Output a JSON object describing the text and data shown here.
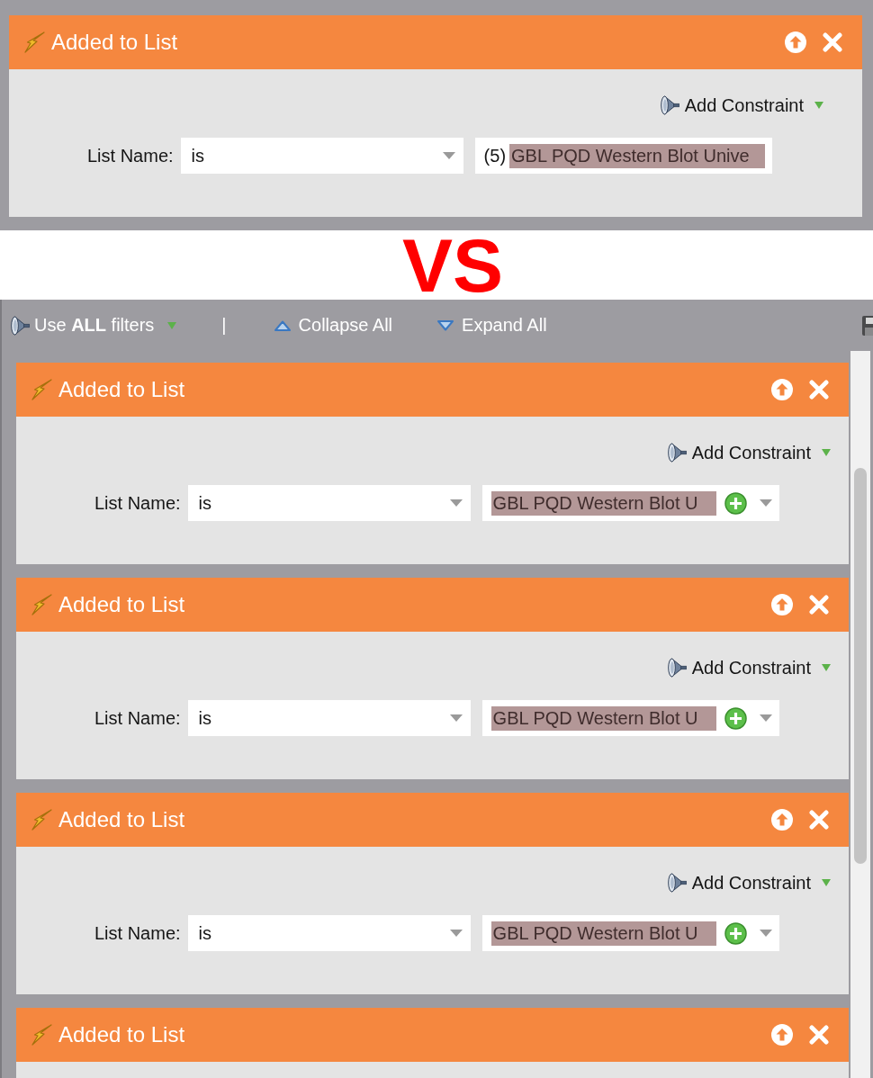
{
  "comparison_top": {
    "filter": {
      "title": "Added to List",
      "add_constraint": "Add Constraint",
      "field_label": "List Name:",
      "operator": "is",
      "value": {
        "kind": "text",
        "prefix": "(5)",
        "text": "GBL PQD Western Blot Unive"
      }
    }
  },
  "divider_label": "VS",
  "filter_panel": {
    "toolbar": {
      "match_rule": "Use **ALL** filters",
      "separator": "|",
      "collapse": "Collapse All",
      "expand": "Expand All"
    },
    "filters": [
      {
        "title": "Added to List",
        "add_constraint": "Add Constraint",
        "field_label": "List Name:",
        "operator": "is",
        "value": {
          "kind": "picker",
          "text": "GBL PQD Western Blot U"
        }
      },
      {
        "title": "Added to List",
        "add_constraint": "Add Constraint",
        "field_label": "List Name:",
        "operator": "is",
        "value": {
          "kind": "picker",
          "text": "GBL PQD Western Blot U"
        }
      },
      {
        "title": "Added to List",
        "add_constraint": "Add Constraint",
        "field_label": "List Name:",
        "operator": "is",
        "value": {
          "kind": "picker",
          "text": "GBL PQD Western Blot U"
        }
      },
      {
        "title": "Added to List"
      }
    ]
  }
}
